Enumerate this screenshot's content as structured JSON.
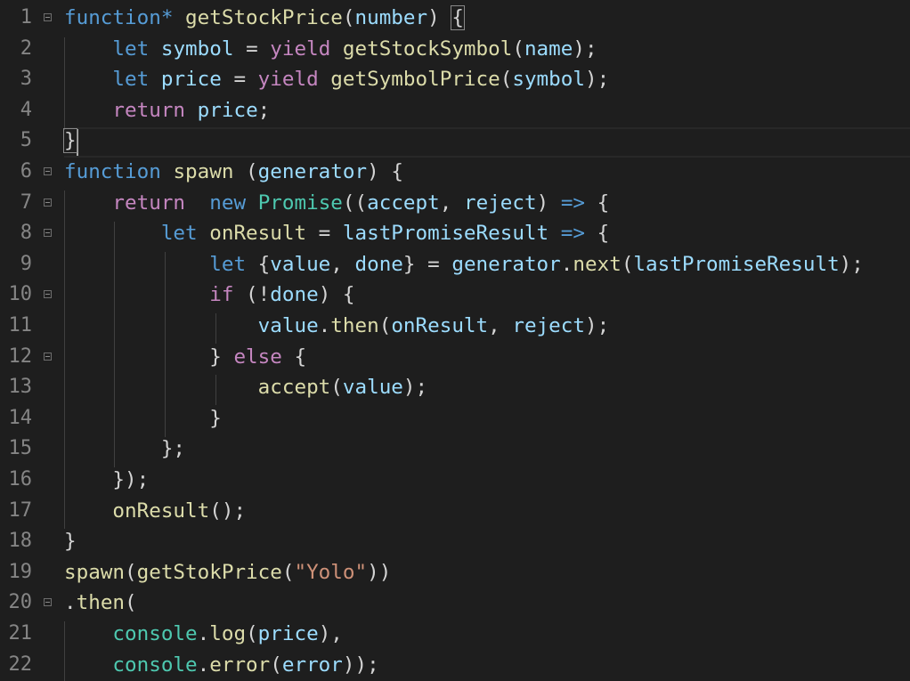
{
  "editor": {
    "language": "javascript",
    "lines": [
      {
        "n": "1",
        "foldable": true,
        "tokens": [
          [
            "kw",
            "function"
          ],
          [
            "kw",
            "*"
          ],
          [
            "pun",
            " "
          ],
          [
            "fn",
            "getStockPrice"
          ],
          [
            "pun",
            "("
          ],
          [
            "var",
            "number"
          ],
          [
            "pun",
            ") "
          ],
          [
            "brk",
            "{"
          ]
        ]
      },
      {
        "n": "2",
        "foldable": false,
        "tokens": [
          [
            "pun",
            "    "
          ],
          [
            "kw",
            "let"
          ],
          [
            "pun",
            " "
          ],
          [
            "var",
            "symbol"
          ],
          [
            "pun",
            " = "
          ],
          [
            "ctl",
            "yield"
          ],
          [
            "pun",
            " "
          ],
          [
            "fn",
            "getStockSymbol"
          ],
          [
            "pun",
            "("
          ],
          [
            "var",
            "name"
          ],
          [
            "pun",
            ");"
          ]
        ]
      },
      {
        "n": "3",
        "foldable": false,
        "tokens": [
          [
            "pun",
            "    "
          ],
          [
            "kw",
            "let"
          ],
          [
            "pun",
            " "
          ],
          [
            "var",
            "price"
          ],
          [
            "pun",
            " = "
          ],
          [
            "ctl",
            "yield"
          ],
          [
            "pun",
            " "
          ],
          [
            "fn",
            "getSymbolPrice"
          ],
          [
            "pun",
            "("
          ],
          [
            "var",
            "symbol"
          ],
          [
            "pun",
            ");"
          ]
        ]
      },
      {
        "n": "4",
        "foldable": false,
        "tokens": [
          [
            "pun",
            "    "
          ],
          [
            "ctl",
            "return"
          ],
          [
            "pun",
            " "
          ],
          [
            "var",
            "price"
          ],
          [
            "pun",
            ";"
          ]
        ]
      },
      {
        "n": "5",
        "foldable": false,
        "tokens": [
          [
            "brk",
            "}"
          ]
        ]
      },
      {
        "n": "6",
        "foldable": true,
        "tokens": [
          [
            "kw",
            "function"
          ],
          [
            "pun",
            " "
          ],
          [
            "fn",
            "spawn"
          ],
          [
            "pun",
            " ("
          ],
          [
            "var",
            "generator"
          ],
          [
            "pun",
            ") {"
          ]
        ]
      },
      {
        "n": "7",
        "foldable": true,
        "tokens": [
          [
            "pun",
            "    "
          ],
          [
            "ctl",
            "return"
          ],
          [
            "pun",
            "  "
          ],
          [
            "kw",
            "new"
          ],
          [
            "pun",
            " "
          ],
          [
            "cls",
            "Promise"
          ],
          [
            "pun",
            "(("
          ],
          [
            "var",
            "accept"
          ],
          [
            "pun",
            ", "
          ],
          [
            "var",
            "reject"
          ],
          [
            "pun",
            ") "
          ],
          [
            "kw",
            "=>"
          ],
          [
            "pun",
            " {"
          ]
        ]
      },
      {
        "n": "8",
        "foldable": true,
        "tokens": [
          [
            "pun",
            "        "
          ],
          [
            "kw",
            "let"
          ],
          [
            "pun",
            " "
          ],
          [
            "fn",
            "onResult"
          ],
          [
            "pun",
            " = "
          ],
          [
            "var",
            "lastPromiseResult"
          ],
          [
            "pun",
            " "
          ],
          [
            "kw",
            "=>"
          ],
          [
            "pun",
            " {"
          ]
        ]
      },
      {
        "n": "9",
        "foldable": false,
        "tokens": [
          [
            "pun",
            "            "
          ],
          [
            "kw",
            "let"
          ],
          [
            "pun",
            " {"
          ],
          [
            "var",
            "value"
          ],
          [
            "pun",
            ", "
          ],
          [
            "var",
            "done"
          ],
          [
            "pun",
            "} = "
          ],
          [
            "var",
            "generator"
          ],
          [
            "pun",
            "."
          ],
          [
            "fn",
            "next"
          ],
          [
            "pun",
            "("
          ],
          [
            "var",
            "lastPromiseResult"
          ],
          [
            "pun",
            ");"
          ]
        ]
      },
      {
        "n": "10",
        "foldable": true,
        "tokens": [
          [
            "pun",
            "            "
          ],
          [
            "ctl",
            "if"
          ],
          [
            "pun",
            " (!"
          ],
          [
            "var",
            "done"
          ],
          [
            "pun",
            ") {"
          ]
        ]
      },
      {
        "n": "11",
        "foldable": false,
        "tokens": [
          [
            "pun",
            "                "
          ],
          [
            "var",
            "value"
          ],
          [
            "pun",
            "."
          ],
          [
            "fn",
            "then"
          ],
          [
            "pun",
            "("
          ],
          [
            "var",
            "onResult"
          ],
          [
            "pun",
            ", "
          ],
          [
            "var",
            "reject"
          ],
          [
            "pun",
            ");"
          ]
        ]
      },
      {
        "n": "12",
        "foldable": true,
        "tokens": [
          [
            "pun",
            "            } "
          ],
          [
            "ctl",
            "else"
          ],
          [
            "pun",
            " {"
          ]
        ]
      },
      {
        "n": "13",
        "foldable": false,
        "tokens": [
          [
            "pun",
            "                "
          ],
          [
            "fn",
            "accept"
          ],
          [
            "pun",
            "("
          ],
          [
            "var",
            "value"
          ],
          [
            "pun",
            ");"
          ]
        ]
      },
      {
        "n": "14",
        "foldable": false,
        "tokens": [
          [
            "pun",
            "            }"
          ]
        ]
      },
      {
        "n": "15",
        "foldable": false,
        "tokens": [
          [
            "pun",
            "        };"
          ]
        ]
      },
      {
        "n": "16",
        "foldable": false,
        "tokens": [
          [
            "pun",
            "    });"
          ]
        ]
      },
      {
        "n": "17",
        "foldable": false,
        "tokens": [
          [
            "pun",
            "    "
          ],
          [
            "fn",
            "onResult"
          ],
          [
            "pun",
            "();"
          ]
        ]
      },
      {
        "n": "18",
        "foldable": false,
        "tokens": [
          [
            "pun",
            "}"
          ]
        ]
      },
      {
        "n": "19",
        "foldable": false,
        "tokens": [
          [
            "fn",
            "spawn"
          ],
          [
            "pun",
            "("
          ],
          [
            "fn",
            "getStokPrice"
          ],
          [
            "pun",
            "("
          ],
          [
            "str",
            "\"Yolo\""
          ],
          [
            "pun",
            "))"
          ]
        ]
      },
      {
        "n": "20",
        "foldable": true,
        "tokens": [
          [
            "pun",
            "."
          ],
          [
            "fn",
            "then"
          ],
          [
            "pun",
            "("
          ]
        ]
      },
      {
        "n": "21",
        "foldable": false,
        "tokens": [
          [
            "pun",
            "    "
          ],
          [
            "cls",
            "console"
          ],
          [
            "pun",
            "."
          ],
          [
            "fn",
            "log"
          ],
          [
            "pun",
            "("
          ],
          [
            "var",
            "price"
          ],
          [
            "pun",
            "),"
          ]
        ]
      },
      {
        "n": "22",
        "foldable": false,
        "tokens": [
          [
            "pun",
            "    "
          ],
          [
            "cls",
            "console"
          ],
          [
            "pun",
            "."
          ],
          [
            "fn",
            "error"
          ],
          [
            "pun",
            "("
          ],
          [
            "var",
            "error"
          ],
          [
            "pun",
            "));"
          ]
        ]
      }
    ]
  },
  "colors": {
    "background": "#1e1e1e",
    "line_number": "#858585",
    "keyword": "#569cd6",
    "control": "#c586c0",
    "function": "#dcdcaa",
    "variable": "#9cdcfe",
    "class": "#4ec9b0",
    "string": "#ce9178",
    "punctuation": "#d4d4d4"
  }
}
